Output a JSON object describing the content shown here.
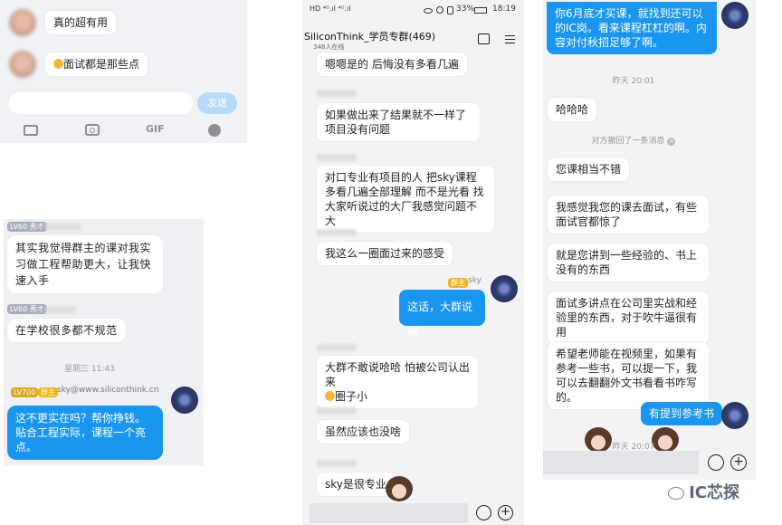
{
  "panel1": {
    "messages": [
      "真的超有用",
      "面试都是那些点"
    ],
    "send_label": "发送",
    "toolbar_gif": "GIF"
  },
  "panel2": {
    "level_badge_1": "LV60 秀才",
    "msg_1": "其实我觉得群主的课对我实习做工程帮助更大，让我快速入手",
    "level_badge_2": "LV60 秀才",
    "msg_2": "在学校很多都不规范",
    "time": "星期三 11:43",
    "sender_level": "LV700",
    "sender_role": "群主",
    "sender_email": "sky@www.siliconthink.cn",
    "msg_3": "这不更实在吗？帮你挣钱。贴合工程实际，课程一个亮点。"
  },
  "phone": {
    "status_left": "HD ⁴ᴳ.ıl ⁴ᴳ.ıl",
    "battery_pct": "33%",
    "time": "18:19",
    "group_title": "SiliconThink_学员专群(469)",
    "online_count": "348人在线",
    "messages": [
      "嗯嗯是的 后悔没有多看几遍",
      "如果做出来了结果就不一样了 项目没有问题",
      "对口专业有项目的人 把sky课程多看几遍全部理解 而不是光看 找大家听说过的大厂我感觉问题不大",
      "我这么一圈面过来的感受",
      "这话，大群说啊",
      "大群不敢说哈哈 怕被公司认出来",
      "圈子小",
      "虽然应该也没啥",
      "sky是很专业"
    ],
    "owner_badge": "群主",
    "owner_name": "sky"
  },
  "panel4": {
    "top_message": "你6月底才买课，就找到还可以的IC岗。看来课程杠杠的啊。内容对付秋招足够了啊。",
    "time_yesterday": "昨天 20:01",
    "messages": [
      "哈哈哈",
      "您课相当不错",
      "我感觉我您的课去面试，有些面试官都惊了",
      "就是您讲到一些经验的、书上没有的东西",
      "面试多讲点在公司里实战和经验里的东西，对于吹牛逼很有用",
      "希望老师能在视频里，如果有参考一些书，可以提一下，我可以去翻翻外文书看看书咋写的。"
    ],
    "recall_notice": "对方撤回了一条消息",
    "blue_reply": "有提到参考书",
    "time_bottom": "昨天 20:07"
  },
  "watermark": "IC芯探"
}
